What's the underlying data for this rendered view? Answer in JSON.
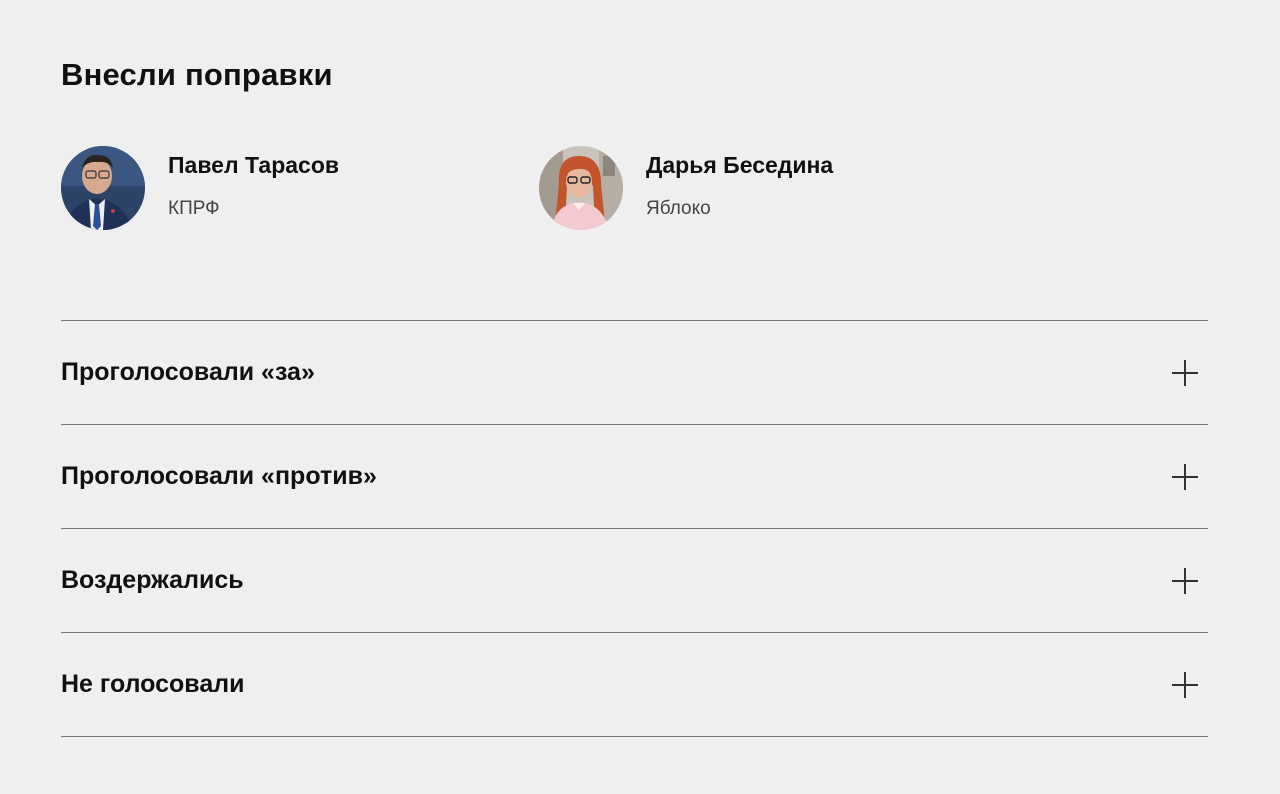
{
  "section": {
    "title": "Внесли поправки"
  },
  "authors": [
    {
      "name": "Павел Тарасов",
      "party": "КПРФ",
      "avatar": "male-portrait-photo"
    },
    {
      "name": "Дарья Беседина",
      "party": "Яблоко",
      "avatar": "female-portrait-photo"
    }
  ],
  "votes": [
    {
      "label": "Проголосовали «за»",
      "icon": "plus-icon"
    },
    {
      "label": "Проголосовали «против»",
      "icon": "plus-icon"
    },
    {
      "label": "Воздержались",
      "icon": "plus-icon"
    },
    {
      "label": "Не голосовали",
      "icon": "plus-icon"
    }
  ],
  "colors": {
    "background": "#efefef",
    "text": "#111111",
    "muted": "#444444",
    "divider": "#7a7a7a"
  }
}
